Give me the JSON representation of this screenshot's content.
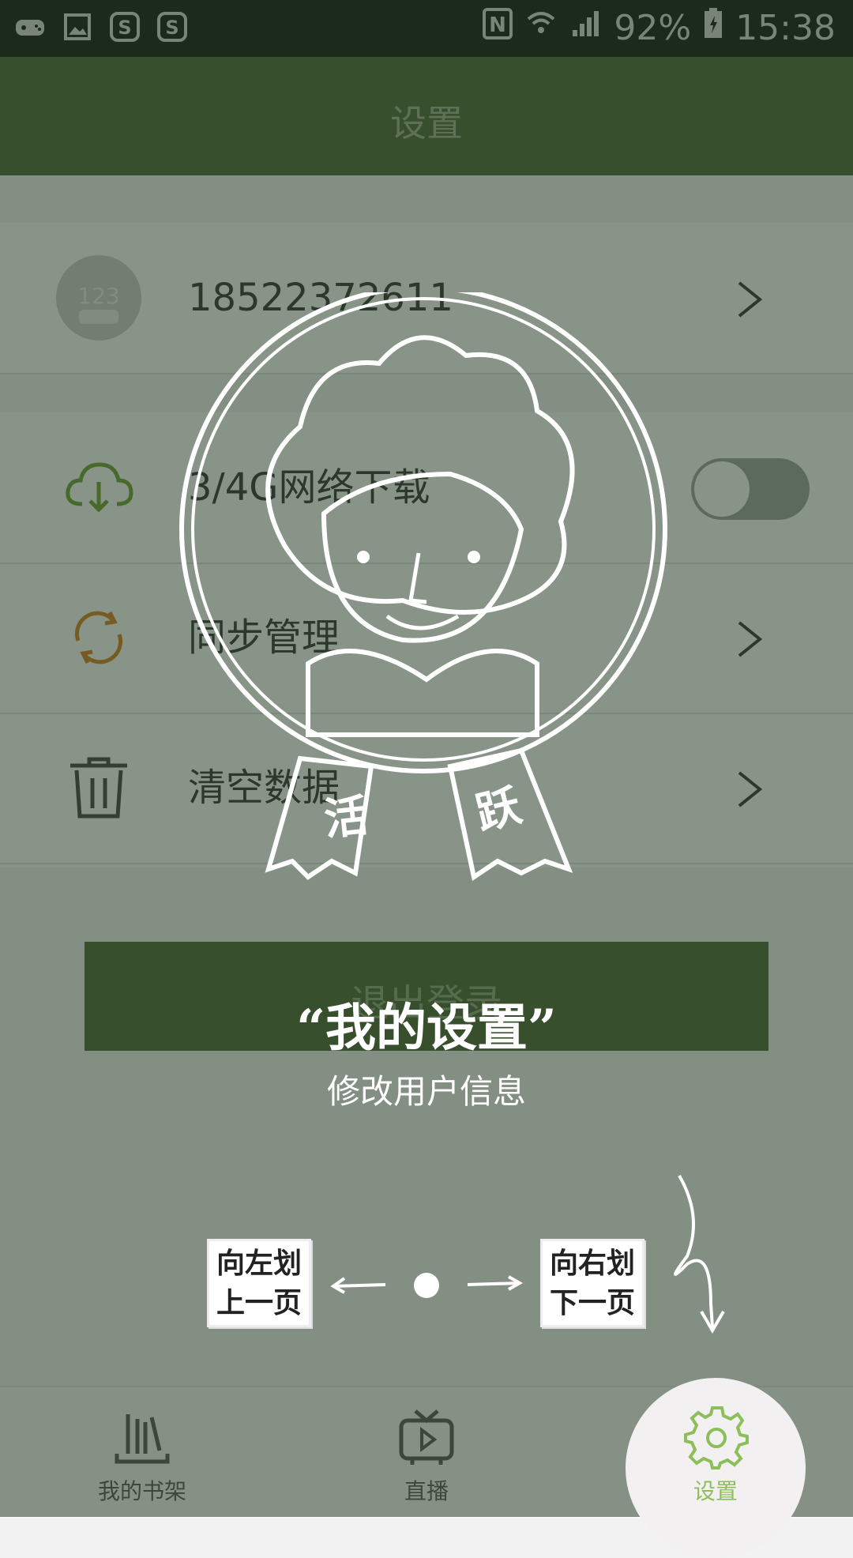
{
  "status_bar": {
    "left_icons": [
      "game-icon",
      "image-icon",
      "s-app-icon",
      "s-app-icon"
    ],
    "battery_percent": "92%",
    "time": "15:38"
  },
  "header": {
    "title": "设置"
  },
  "account": {
    "phone": "18522372611"
  },
  "settings": {
    "network_download_label": "3/4G网络下载",
    "network_download_enabled": false,
    "sync_label": "同步管理",
    "clear_label": "清空数据"
  },
  "logout": {
    "label": "退出登录"
  },
  "tabs": [
    {
      "label": "我的书架",
      "icon": "bookshelf-icon"
    },
    {
      "label": "直播",
      "icon": "tv-play-icon"
    },
    {
      "label": "设置",
      "icon": "gear-icon"
    }
  ],
  "coach": {
    "badge_text_left": "活",
    "badge_text_right": "跃",
    "title": "“我的设置”",
    "subtitle": "修改用户信息",
    "left_hint_line1": "向左划",
    "left_hint_line2": "上一页",
    "right_hint_line1": "向右划",
    "right_hint_line2": "下一页"
  },
  "colors": {
    "brand_green": "#4a6632",
    "active_tab": "#8cbf5a",
    "sync_orange": "#d4841c"
  }
}
